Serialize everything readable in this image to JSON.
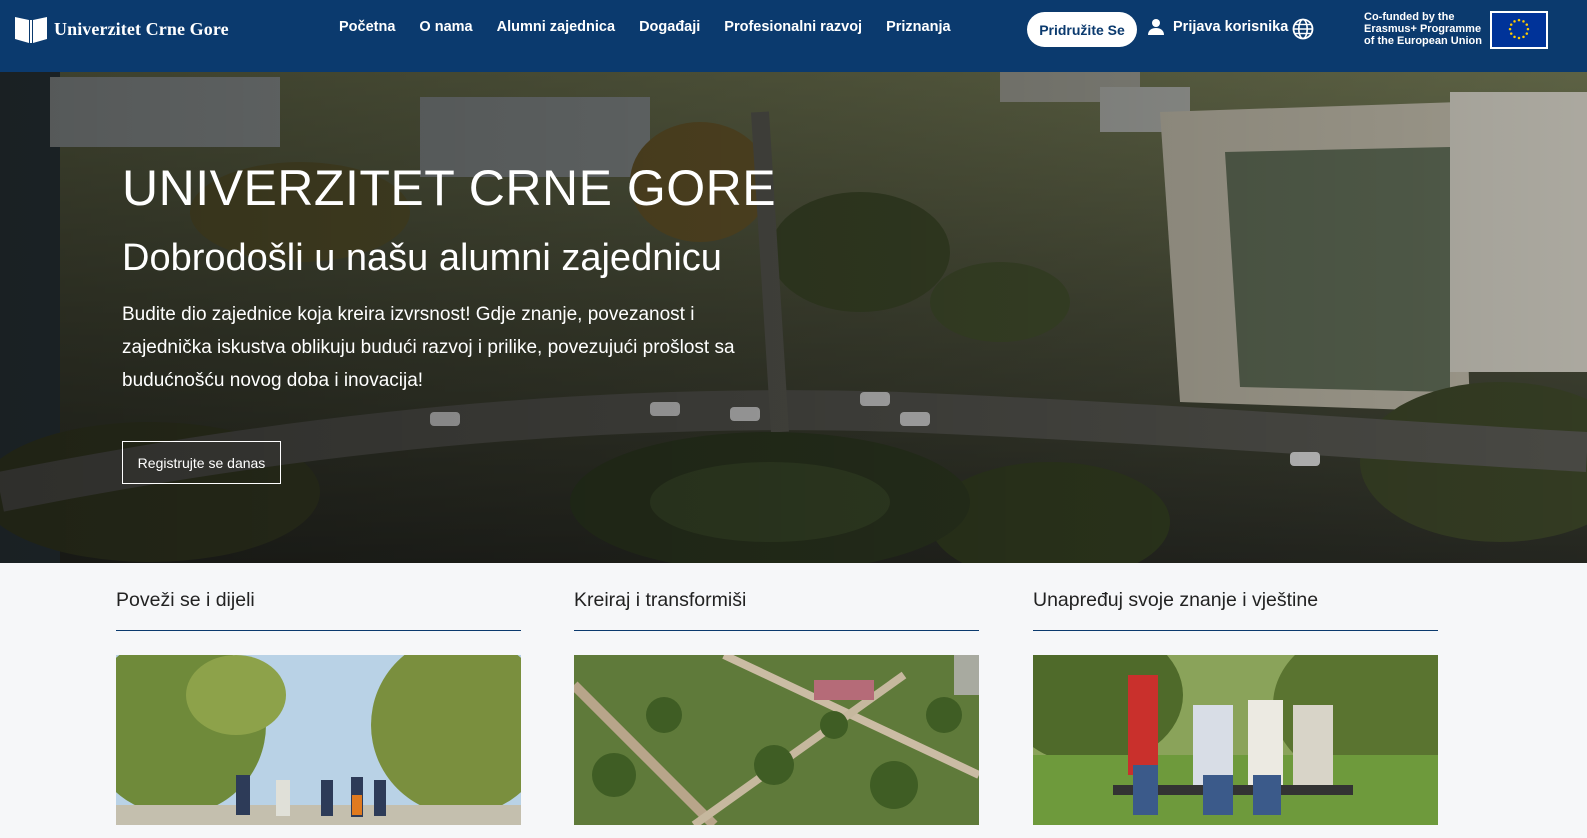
{
  "header": {
    "logo_text": "Univerzitet Crne Gore",
    "nav": [
      "Početna",
      "O nama",
      "Alumni zajednica",
      "Događaji",
      "Profesionalni razvoj",
      "Priznanja"
    ],
    "join_label": "Pridružite Se",
    "login_label": "Prijava korisnika",
    "erasmus_lines": [
      "Co-funded by the",
      "Erasmus+ Programme",
      "of the European Union"
    ]
  },
  "hero": {
    "title": "UNIVERZITET CRNE GORE",
    "subtitle": "Dobrodošli u našu alumni zajednicu",
    "text": "Budite dio zajednice koja kreira izvrsnost! Gdje znanje, povezanost i zajednička iskustva oblikuju budući razvoj i prilike, povezujući prošlost sa budućnošću novog doba i inovacija!",
    "cta_label": "Registrujte se danas"
  },
  "cards": [
    {
      "title": "Poveži se i dijeli"
    },
    {
      "title": "Kreiraj i transformiši"
    },
    {
      "title": "Unapređuj svoje znanje i vještine"
    }
  ],
  "colors": {
    "brand": "#0b3a6e",
    "eu_blue": "#003399",
    "eu_gold": "#ffcc00"
  }
}
